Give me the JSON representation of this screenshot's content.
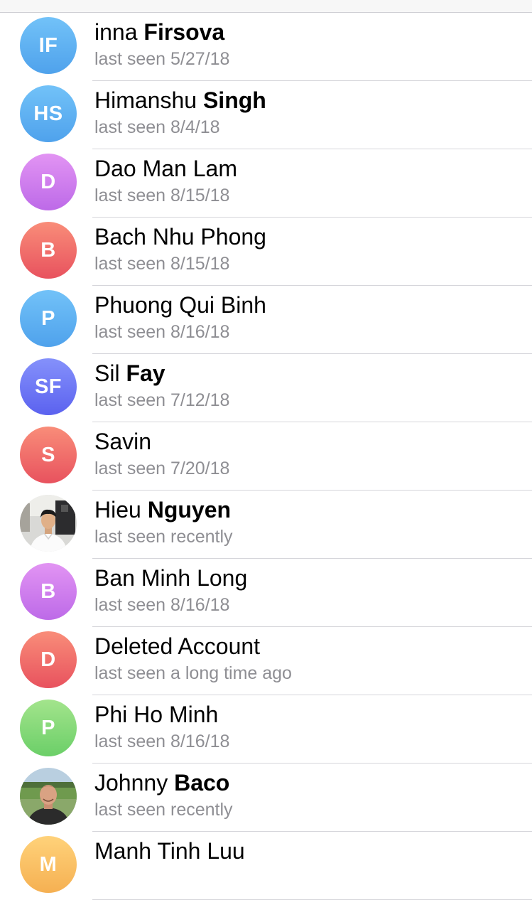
{
  "contacts": [
    {
      "first": "inna",
      "last": "Firsova",
      "status": "last seen 5/27/18",
      "initials": "IF",
      "avatar": "initials",
      "color": "#5aaef2"
    },
    {
      "first": "Himanshu",
      "last": "Singh",
      "status": "last seen 8/4/18",
      "initials": "HS",
      "avatar": "initials",
      "color": "#5aaef2"
    },
    {
      "first": "Dao Man Lam",
      "last": "",
      "status": "last seen 8/15/18",
      "initials": "D",
      "avatar": "initials",
      "color": "#c97aec"
    },
    {
      "first": "Bach Nhu Phong",
      "last": "",
      "status": "last seen 8/15/18",
      "initials": "B",
      "avatar": "initials",
      "color": "#ef6d68"
    },
    {
      "first": "Phuong Qui Binh",
      "last": "",
      "status": "last seen 8/16/18",
      "initials": "P",
      "avatar": "initials",
      "color": "#5aaef2"
    },
    {
      "first": "Sil",
      "last": "Fay",
      "status": "last seen 7/12/18",
      "initials": "SF",
      "avatar": "initials",
      "color": "#6c74f3"
    },
    {
      "first": "Savin",
      "last": "",
      "status": "last seen 7/20/18",
      "initials": "S",
      "avatar": "initials",
      "color": "#ef6d68"
    },
    {
      "first": "Hieu",
      "last": "Nguyen",
      "status": "last seen recently",
      "initials": "",
      "avatar": "photo-man-white-shirt",
      "color": "#e6e6e6"
    },
    {
      "first": "Ban Minh Long",
      "last": "",
      "status": "last seen 8/16/18",
      "initials": "B",
      "avatar": "initials",
      "color": "#c97aec"
    },
    {
      "first": "Deleted Account",
      "last": "",
      "status": "last seen a long time ago",
      "initials": "D",
      "avatar": "initials",
      "color": "#ef6d68"
    },
    {
      "first": "Phi Ho Minh",
      "last": "",
      "status": "last seen 8/16/18",
      "initials": "P",
      "avatar": "initials",
      "color": "#82d878"
    },
    {
      "first": "Johnny",
      "last": "Baco",
      "status": "last seen recently",
      "initials": "",
      "avatar": "photo-man-outdoors",
      "color": "#7aa35c"
    },
    {
      "first": "Manh Tinh Luu",
      "last": "",
      "status": "",
      "initials": "M",
      "avatar": "initials",
      "color": "#f8c063"
    }
  ]
}
